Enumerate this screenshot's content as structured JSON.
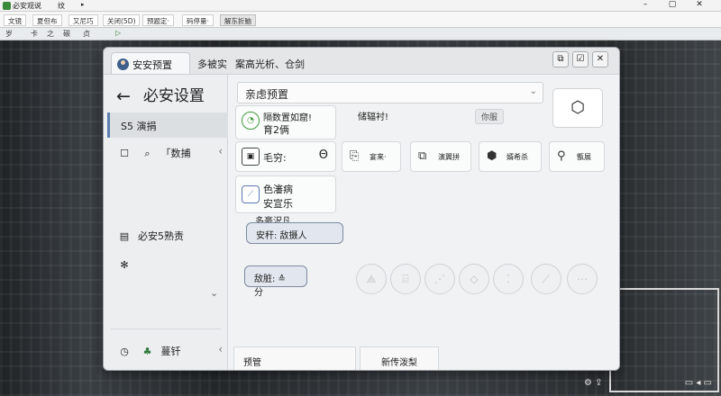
{
  "host": {
    "title": "必安观说",
    "menu_word": "纹",
    "arrow": "▸",
    "menu_items": [
      "文镜",
      "夏但布",
      "又尼巧",
      "关闭(5D)",
      "预题定·",
      "码停量·",
      "解东折脑"
    ],
    "toolbar": [
      "岁",
      "卡",
      "之",
      "碳",
      "贞",
      "▷"
    ]
  },
  "window": {
    "tabs": [
      "安安预置",
      "多被实",
      "案高光析、仓剑"
    ],
    "controls": [
      "⧉",
      "☑",
      "✕"
    ]
  },
  "sidebar": {
    "back_arrow": "←",
    "title": "必安设置",
    "items": [
      {
        "label": "S5 演捐",
        "active": true
      },
      {
        "label": "「数捕",
        "active": false
      },
      {
        "label": "必安5熟责",
        "active": false
      },
      {
        "label": "",
        "active": false
      },
      {
        "label": "蔓钎",
        "active": false
      }
    ],
    "scroll_chevron": "⌄"
  },
  "main": {
    "dropdown_value": "亲虑预置",
    "side_text": "储辐衬!",
    "status_chip": "你服",
    "card1": {
      "line1": "隔数置如窟!",
      "line2": "育2俩"
    },
    "card2": {
      "line1": "毛穷:",
      "extra": "Θ"
    },
    "card3": {
      "line1": "色瀋病",
      "line2": "安宣乐"
    },
    "minis": [
      "宴来·",
      "演翼拼",
      "婿希杀",
      "甑展"
    ],
    "section_label": "多豪沢凡",
    "pill1": "安秆:   敌摄人",
    "pill2": "敌脏: ≙ 分",
    "bottom_left": "预管",
    "bottom_right": "新传泼梨"
  },
  "tray": {
    "left": "⚙ ⇪",
    "right": "▭ ◂ ▭"
  }
}
